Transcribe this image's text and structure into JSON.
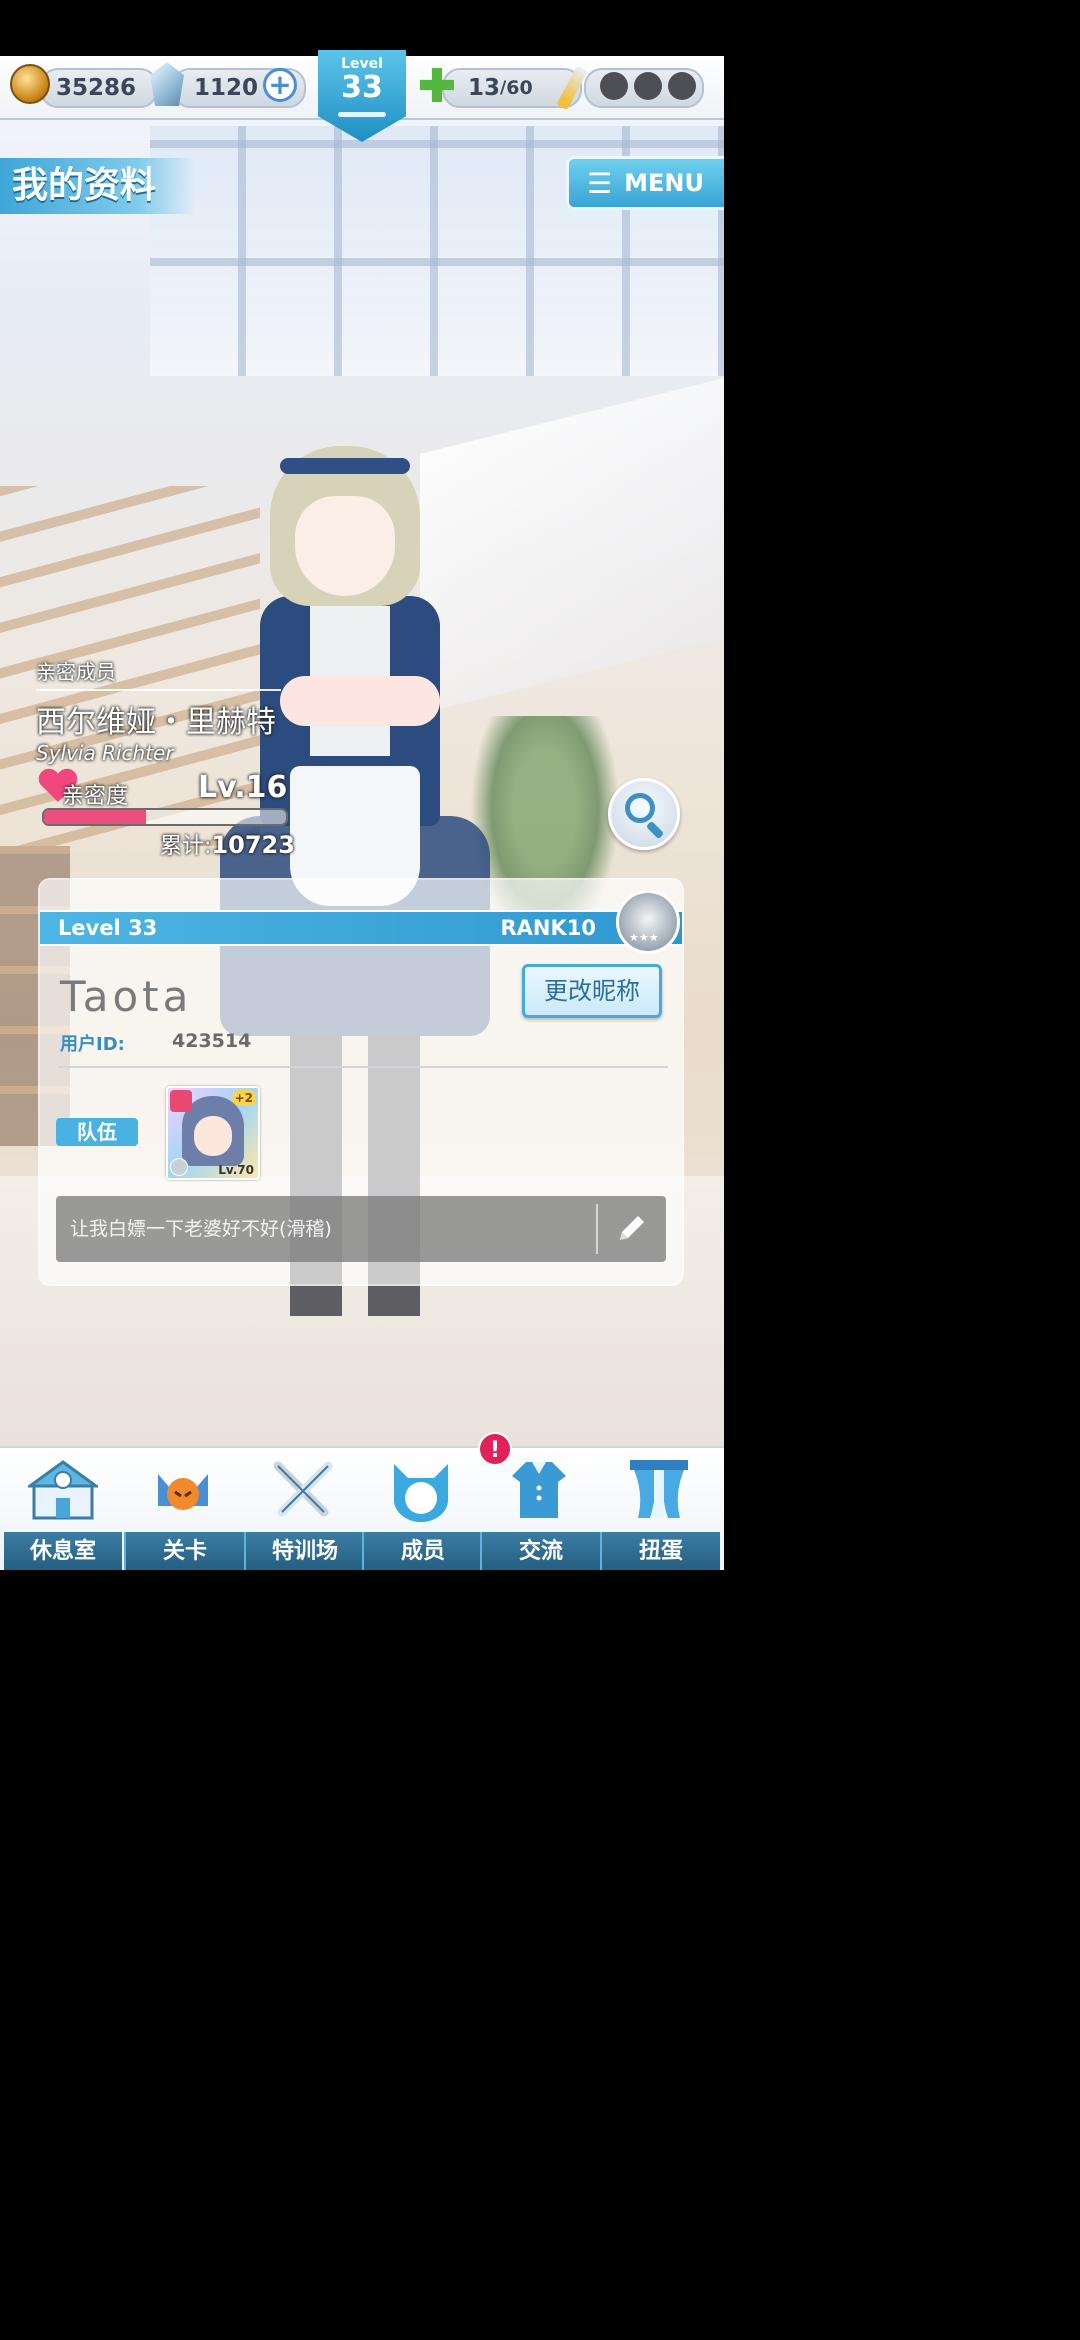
{
  "hud": {
    "coins": "35286",
    "gems": "1120",
    "level_label": "Level",
    "level": "33",
    "stamina_current": "13",
    "stamina_sep": " / ",
    "stamina_max": "60"
  },
  "page": {
    "title": "我的资料",
    "menu_label": "MENU"
  },
  "intimacy": {
    "caption": "亲密成员",
    "name_cn": "西尔维娅・里赫特",
    "name_en": "Sylvia Richter",
    "label": "亲密度",
    "level": "Lv.16",
    "progress": 0.42,
    "total_label": "累计:",
    "total_value": "10723"
  },
  "profile": {
    "level": "Level 33",
    "rank": "RANK10",
    "nickname": "Taota",
    "uid_label": "用户ID:",
    "uid_value": "423514",
    "rename_label": "更改昵称",
    "team_label": "队伍",
    "team_card_bonus": "+2",
    "team_card_level": "Lv.70",
    "signature": "让我白嫖一下老婆好不好(滑稽)"
  },
  "nav": {
    "items": [
      {
        "label": "休息室",
        "icon": "lounge-icon"
      },
      {
        "label": "关卡",
        "icon": "stage-icon"
      },
      {
        "label": "特训场",
        "icon": "training-icon"
      },
      {
        "label": "成员",
        "icon": "members-icon"
      },
      {
        "label": "交流",
        "icon": "exchange-icon"
      },
      {
        "label": "扭蛋",
        "icon": "gacha-icon"
      }
    ],
    "exchange_badge": "!"
  },
  "colors": {
    "accent": "#3fa6d8",
    "affection": "#ea4f7e",
    "badge": "#e0215a"
  }
}
